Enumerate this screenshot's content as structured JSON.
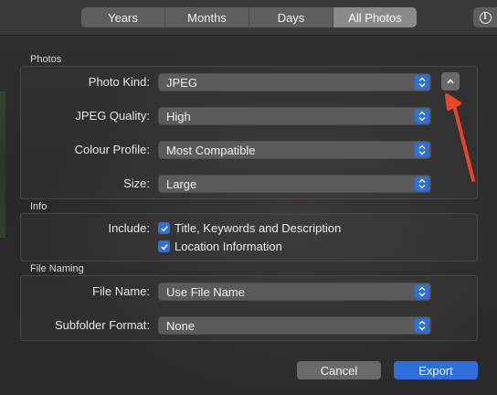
{
  "toolbar": {
    "tabs": [
      "Years",
      "Months",
      "Days",
      "All Photos"
    ],
    "active_tab": "All Photos"
  },
  "photos": {
    "section_label": "Photos",
    "rows": [
      {
        "label": "Photo Kind:",
        "value": "JPEG"
      },
      {
        "label": "JPEG Quality:",
        "value": "High"
      },
      {
        "label": "Colour Profile:",
        "value": "Most Compatible"
      },
      {
        "label": "Size:",
        "value": "Large"
      }
    ]
  },
  "info": {
    "section_label": "Info",
    "include_label": "Include:",
    "options": [
      {
        "label": "Title, Keywords and Description",
        "checked": true
      },
      {
        "label": "Location Information",
        "checked": true
      }
    ]
  },
  "file_naming": {
    "section_label": "File Naming",
    "rows": [
      {
        "label": "File Name:",
        "value": "Use File Name"
      },
      {
        "label": "Subfolder Format:",
        "value": "None"
      }
    ]
  },
  "buttons": {
    "cancel": "Cancel",
    "export": "Export"
  },
  "colors": {
    "accent": "#2f6fdc",
    "annotation_arrow": "#e8442a"
  },
  "icons": {
    "info": "info-circle-icon",
    "disclosure": "chevron-up-icon",
    "popup": "up-down-chevron-icon",
    "check": "checkmark-icon"
  }
}
